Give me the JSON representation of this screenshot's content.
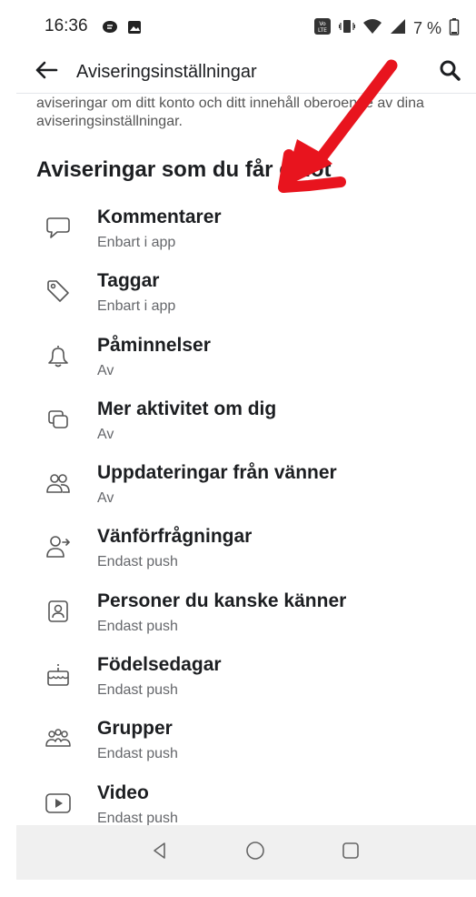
{
  "status_bar": {
    "time": "16:36",
    "battery_text": "7 %",
    "icons": [
      "bubble-icon",
      "image-icon",
      "volte-icon",
      "vibrate-icon",
      "wifi-icon",
      "signal-icon",
      "battery-icon"
    ]
  },
  "app_bar": {
    "title": "Aviseringsinställningar",
    "back_icon": "arrow-left-icon",
    "search_icon": "search-icon"
  },
  "intro_text": "aviseringar om ditt konto och ditt innehåll oberoende av dina aviseringsinställningar.",
  "section_title": "Aviseringar som du får emot",
  "items": [
    {
      "label": "Kommentarer",
      "sub": "Enbart i app",
      "icon": "comment-icon"
    },
    {
      "label": "Taggar",
      "sub": "Enbart i app",
      "icon": "tag-icon"
    },
    {
      "label": "Påminnelser",
      "sub": "Av",
      "icon": "bell-icon"
    },
    {
      "label": "Mer aktivitet om dig",
      "sub": "Av",
      "icon": "stacked-squares-icon"
    },
    {
      "label": "Uppdateringar från vänner",
      "sub": "Av",
      "icon": "friends-icon"
    },
    {
      "label": "Vänförfrågningar",
      "sub": "Endast push",
      "icon": "friend-request-icon"
    },
    {
      "label": "Personer du kanske känner",
      "sub": "Endast push",
      "icon": "contact-card-icon"
    },
    {
      "label": "Födelsedagar",
      "sub": "Endast push",
      "icon": "cake-icon"
    },
    {
      "label": "Grupper",
      "sub": "Endast push",
      "icon": "groups-icon"
    },
    {
      "label": "Video",
      "sub": "Endast push",
      "icon": "video-play-icon"
    }
  ],
  "nav_bar": {
    "back": "triangle-back-icon",
    "home": "circle-home-icon",
    "recents": "square-recents-icon"
  },
  "annotation": {
    "color": "#e8141e",
    "icon": "red-arrow-icon"
  }
}
